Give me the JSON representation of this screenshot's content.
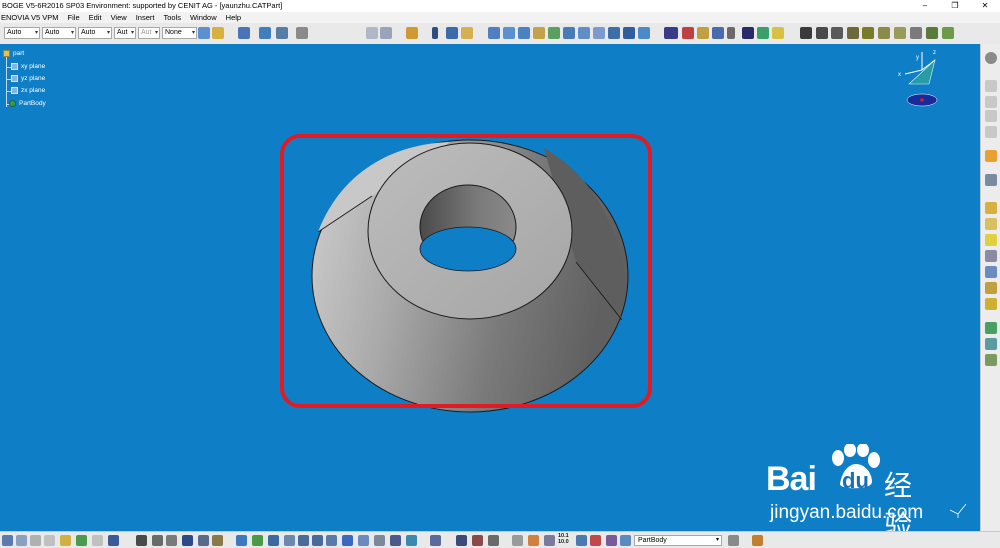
{
  "window": {
    "title": "BOGE V5-6R2016 SP03 Environment: supported by CENIT AG - [yaunzhu.CATPart]",
    "minimize": "–",
    "restore": "❐",
    "close": "✕"
  },
  "menu": {
    "items": [
      "ENOVIA V5 VPM",
      "File",
      "Edit",
      "View",
      "Insert",
      "Tools",
      "Window",
      "Help"
    ]
  },
  "toolbar": {
    "combos": [
      "Auto",
      "Auto",
      "Auto",
      "Aut",
      "Aut",
      "None"
    ]
  },
  "tree": {
    "root": "part",
    "planes": [
      "xy plane",
      "yz plane",
      "zx plane"
    ],
    "body": "PartBody"
  },
  "bottombar": {
    "body_combo": "PartBody",
    "measure_top": "10.1",
    "measure_bottom": "10.0"
  },
  "compass": {
    "x_label": "x",
    "y_label": "y",
    "z_label": "z"
  },
  "watermark": {
    "brand": "Bai",
    "brand_suffix": "du",
    "cn": "经验",
    "url": "jingyan.baidu.com"
  },
  "colors": {
    "viewport_bg": "#0e7fc6",
    "highlight_frame": "#e21b23",
    "part_light": "#c9c9c9",
    "part_dark": "#6b6b6b"
  }
}
